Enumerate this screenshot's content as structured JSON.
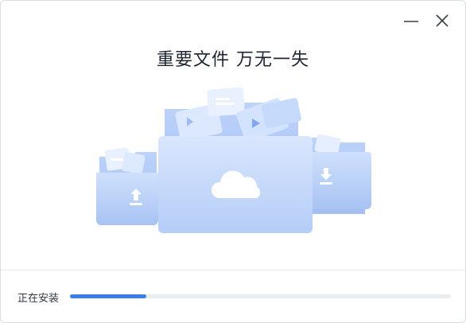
{
  "window": {
    "icons": {
      "minimize": "minimize-icon",
      "close": "close-icon"
    }
  },
  "headline": "重要文件 万无一失",
  "install": {
    "status_label": "正在安装",
    "progress": 0.2
  },
  "colors": {
    "accent": "#3d7de6",
    "track": "#e9ecf0",
    "folder_light": "#c9dbfb",
    "folder_mid": "#a9c5f5"
  },
  "illustration": {
    "icons": [
      "upload-icon",
      "cloud-icon",
      "download-icon"
    ]
  }
}
